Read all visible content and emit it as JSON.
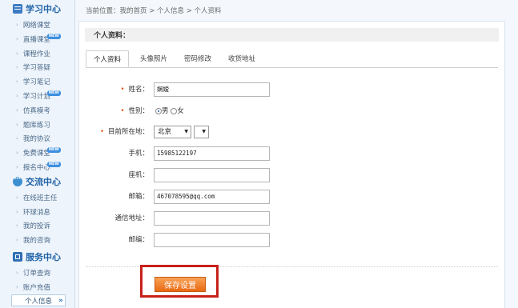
{
  "sidebar": {
    "study": {
      "title": "学习中心",
      "items": [
        {
          "label": "网络课堂",
          "badge": ""
        },
        {
          "label": "直播课堂",
          "badge": "NEW"
        },
        {
          "label": "课程作业",
          "badge": ""
        },
        {
          "label": "学习答疑",
          "badge": ""
        },
        {
          "label": "学习笔记",
          "badge": ""
        },
        {
          "label": "学习计划",
          "badge": "NEW"
        },
        {
          "label": "仿真模考",
          "badge": ""
        },
        {
          "label": "题库练习",
          "badge": ""
        },
        {
          "label": "我的协议",
          "badge": ""
        },
        {
          "label": "免费课堂",
          "badge": "NEW"
        },
        {
          "label": "报名中心",
          "badge": "NEW"
        }
      ]
    },
    "exchange": {
      "title": "交流中心",
      "items": [
        {
          "label": "在线班主任"
        },
        {
          "label": "环球消息"
        },
        {
          "label": "我的投诉"
        },
        {
          "label": "我的咨询"
        }
      ]
    },
    "service": {
      "title": "服务中心",
      "items": [
        {
          "label": "订单查询"
        },
        {
          "label": "账户充值"
        }
      ],
      "active_item": "个人信息",
      "active_arrow": "»"
    }
  },
  "breadcrumb": "当前位置：我的首页 > 个人信息 > 个人资料",
  "panel_title": "个人资料：",
  "tabs": [
    {
      "label": "个人资料",
      "active": true
    },
    {
      "label": "头像照片",
      "active": false
    },
    {
      "label": "密码修改",
      "active": false
    },
    {
      "label": "收货地址",
      "active": false
    }
  ],
  "form": {
    "name": {
      "label": "姓名：",
      "required": "•",
      "value": "娴嫒"
    },
    "gender": {
      "label": "性别：",
      "required": "•",
      "male": "男",
      "female": "女",
      "selected": "男"
    },
    "location": {
      "label": "目前所在地：",
      "required": "•",
      "province": "北京",
      "city": ""
    },
    "mobile": {
      "label": "手机：",
      "value": "15985122197"
    },
    "landline": {
      "label": "座机：",
      "value": ""
    },
    "email": {
      "label": "邮箱：",
      "value": "467078595@qq.com"
    },
    "address": {
      "label": "通信地址：",
      "value": ""
    },
    "zipcode": {
      "label": "邮编：",
      "value": ""
    }
  },
  "save_label": "保存设置",
  "colors": {
    "accent": "#ea6912",
    "highlight": "#c8201a",
    "sidebar_title": "#1f62a8"
  }
}
